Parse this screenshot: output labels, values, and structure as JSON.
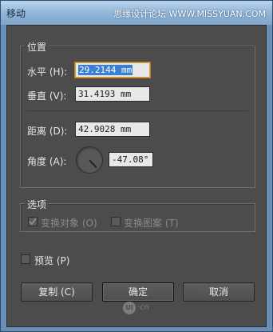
{
  "window": {
    "title": "移动",
    "watermark": "思缘设计论坛 WWW.MISSYUAN.COM"
  },
  "position": {
    "legend": "位置",
    "horizontal": {
      "label": "水平 (H):",
      "value": "29.2144 mm"
    },
    "vertical": {
      "label": "垂直 (V):",
      "value": "31.4193 mm"
    },
    "distance": {
      "label": "距离 (D):",
      "value": "42.9028 mm"
    },
    "angle": {
      "label": "角度 (A):",
      "value": "-47.08°",
      "degrees": -47.08
    }
  },
  "options": {
    "legend": "选项",
    "transform_objects": {
      "label": "变换对象 (O)",
      "checked": true,
      "enabled": false
    },
    "transform_patterns": {
      "label": "变换图案 (T)",
      "checked": false,
      "enabled": false
    }
  },
  "preview": {
    "label": "预览 (P)",
    "checked": false
  },
  "buttons": {
    "copy": "复制 (C)",
    "ok": "确定",
    "cancel": "取消"
  },
  "logo": {
    "badge": "UI",
    "text": "·cn"
  },
  "colors": {
    "dialog_bg": "#4c4c4c",
    "titlebar": "#8fb3d6",
    "field_focus": "#d9a24a",
    "selection": "#3a7fd4"
  }
}
